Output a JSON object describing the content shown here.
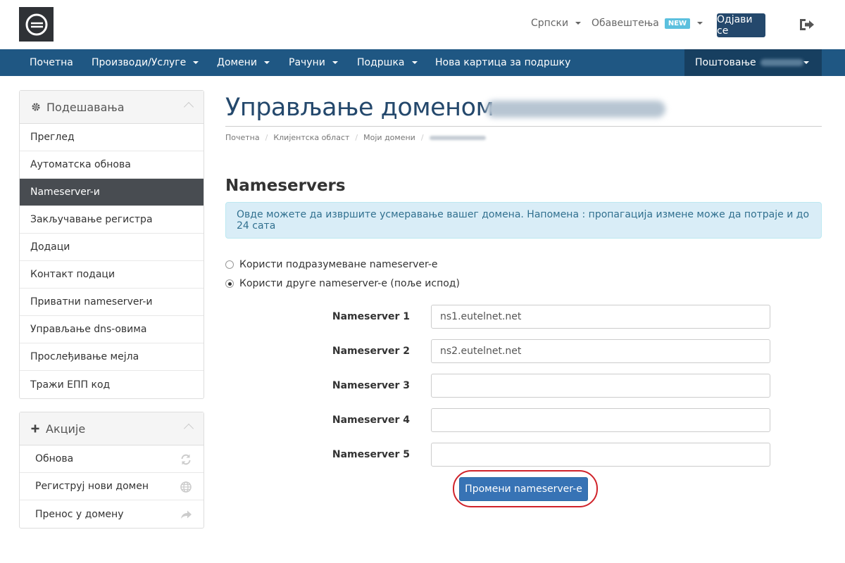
{
  "header": {
    "language": "Српски",
    "notifications": "Обавештења",
    "notifications_badge": "NEW",
    "logout_label": "Одјави се"
  },
  "nav": {
    "items": [
      {
        "label": "Почетна",
        "dropdown": false
      },
      {
        "label": "Производи/Услуге",
        "dropdown": true
      },
      {
        "label": "Домени",
        "dropdown": true
      },
      {
        "label": "Рачуни",
        "dropdown": true
      },
      {
        "label": "Подршка",
        "dropdown": true
      },
      {
        "label": "Нова картица за подршку",
        "dropdown": false
      }
    ],
    "account_greeting": "Поштовање"
  },
  "sidebar": {
    "settings_title": "Подешавања",
    "settings_items": [
      {
        "label": "Преглед"
      },
      {
        "label": "Аутоматска обнова"
      },
      {
        "label": "Nameserver-и",
        "active": true
      },
      {
        "label": "Закључавање регистра"
      },
      {
        "label": "Додаци"
      },
      {
        "label": "Контакт подаци"
      },
      {
        "label": "Приватни nameserver-и"
      },
      {
        "label": "Управљање dns-овима"
      },
      {
        "label": "Прослеђивање мејла"
      },
      {
        "label": "Тражи ЕПП код"
      }
    ],
    "actions_title": "Акције",
    "action_items": [
      {
        "label": "Обнова",
        "icon": "refresh-icon"
      },
      {
        "label": "Региструј нови домен",
        "icon": "globe-icon"
      },
      {
        "label": "Пренос у домену",
        "icon": "share-arrow-icon"
      }
    ]
  },
  "main": {
    "title": "Управљање доменом",
    "breadcrumb": [
      "Почетна",
      "Клијентска област",
      "Моји домени"
    ],
    "section_title": "Nameservers",
    "alert": "Овде можете да извршите усмеравање вашег домена. Напомена : пропагација измене може да потраје и до 24 сата",
    "option_default": "Користи подразумеване nameserver-е",
    "option_custom": "Користи друге nameserver-е (поље испод)",
    "nameservers": [
      {
        "label": "Nameserver 1",
        "value": "ns1.eutelnet.net"
      },
      {
        "label": "Nameserver 2",
        "value": "ns2.eutelnet.net"
      },
      {
        "label": "Nameserver 3",
        "value": ""
      },
      {
        "label": "Nameserver 4",
        "value": ""
      },
      {
        "label": "Nameserver 5",
        "value": ""
      }
    ],
    "submit_label": "Промени nameserver-е"
  },
  "colors": {
    "navbar": "#1f5783",
    "title": "#24486c",
    "accent_button": "#3773b5",
    "highlight_ring": "#d0232a"
  }
}
